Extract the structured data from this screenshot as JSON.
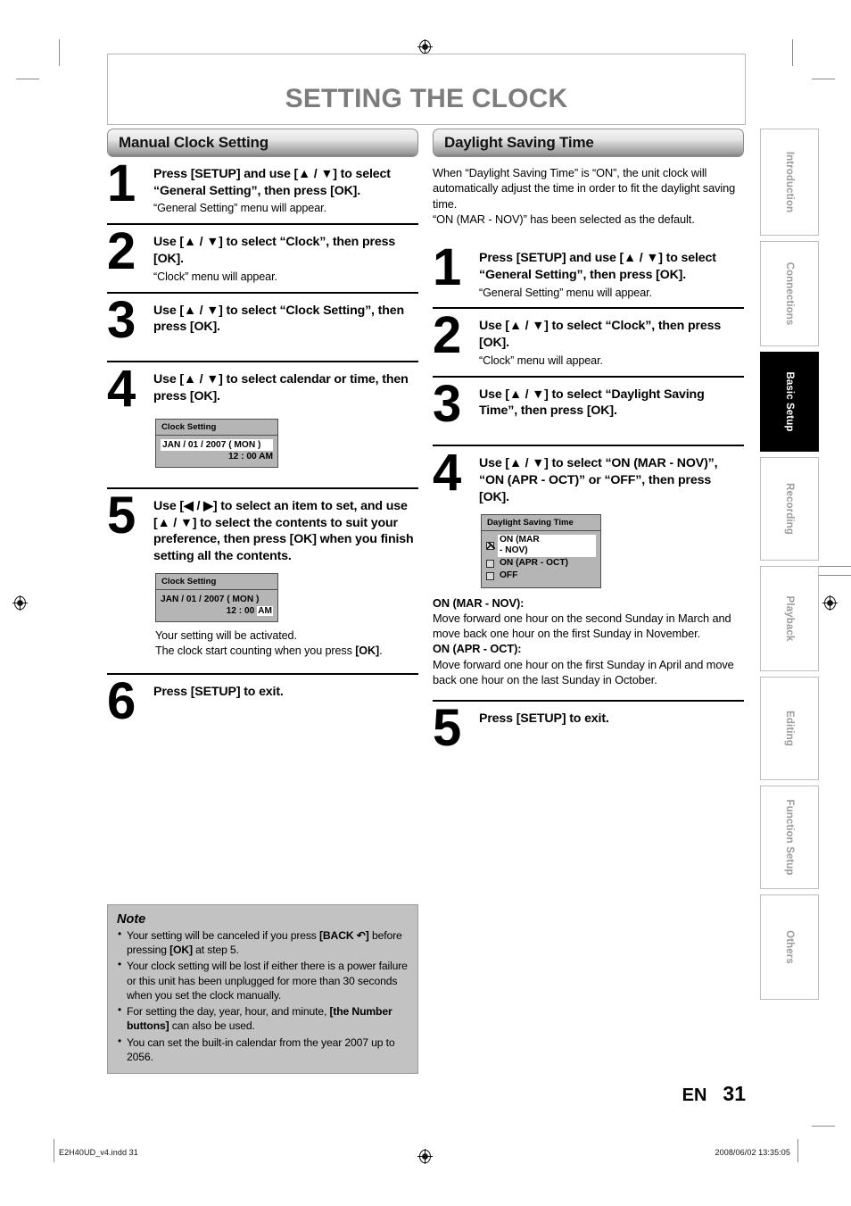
{
  "page": {
    "title": "SETTING THE CLOCK",
    "page_number": "31",
    "language_code": "EN",
    "imprint_left": "E2H40UD_v4.indd   31",
    "imprint_right": "2008/06/02   13:35:05"
  },
  "sidebar": {
    "tabs": [
      {
        "label": "Introduction",
        "active": false
      },
      {
        "label": "Connections",
        "active": false
      },
      {
        "label": "Basic Setup",
        "active": true
      },
      {
        "label": "Recording",
        "active": false
      },
      {
        "label": "Playback",
        "active": false
      },
      {
        "label": "Editing",
        "active": false
      },
      {
        "label": "Function Setup",
        "active": false
      },
      {
        "label": "Others",
        "active": false
      }
    ]
  },
  "left_column": {
    "section_title": "Manual Clock Setting",
    "steps": [
      {
        "number": "1",
        "head": "Press [SETUP] and use [▲ / ▼] to select “General Setting”, then press [OK].",
        "sub": "“General Setting” menu will appear."
      },
      {
        "number": "2",
        "head": "Use [▲ / ▼] to select “Clock”, then press [OK].",
        "sub": "“Clock” menu will appear."
      },
      {
        "number": "3",
        "head": "Use [▲ / ▼] to select “Clock Setting”, then press [OK].",
        "sub": ""
      },
      {
        "number": "4",
        "head": "Use [▲ / ▼] to select calendar or time, then press [OK].",
        "sub": ""
      },
      {
        "number": "5",
        "head": "Use [◀ / ▶] to select an item to set, and use [▲ / ▼] to select the contents to suit your preference, then press [OK] when you finish setting all the contents.",
        "sub": ""
      },
      {
        "number": "6",
        "head": "Press [SETUP] to exit.",
        "sub": ""
      }
    ],
    "osd_step4": {
      "title": "Clock Setting",
      "date": "JAN / 01 / 2007 ( MON )",
      "time_prefix": "12 : 00 ",
      "time_suffix": "AM",
      "highlight": "date"
    },
    "osd_step5": {
      "title": "Clock Setting",
      "date": "JAN / 01 / 2007 ( MON )",
      "time_prefix": "12 : 00 ",
      "time_suffix": "AM",
      "highlight": "ampm"
    },
    "step5_after_1": "Your setting will be activated.",
    "step5_after_2a": "The clock start counting when you press ",
    "step5_after_2b": "[OK]",
    "step5_after_2c": "."
  },
  "right_column": {
    "section_title": "Daylight Saving Time",
    "intro": "When “Daylight Saving Time” is “ON”, the unit clock will automatically adjust the time in order to fit the daylight saving time.\n“ON (MAR - NOV)” has been selected as the default.",
    "steps": [
      {
        "number": "1",
        "head": "Press [SETUP] and use [▲ / ▼] to select “General Setting”, then press [OK].",
        "sub": "“General Setting” menu will appear."
      },
      {
        "number": "2",
        "head": "Use [▲ / ▼] to select “Clock”, then press [OK].",
        "sub": "“Clock” menu will appear."
      },
      {
        "number": "3",
        "head": "Use [▲ / ▼] to select “Daylight Saving Time”, then press [OK].",
        "sub": ""
      },
      {
        "number": "4",
        "head": "Use [▲ / ▼] to select “ON (MAR - NOV)”, “ON (APR - OCT)” or “OFF”, then press [OK].",
        "sub": ""
      },
      {
        "number": "5",
        "head": "Press [SETUP] to exit.",
        "sub": ""
      }
    ],
    "osd_dst": {
      "title": "Daylight Saving Time",
      "options": [
        {
          "label": "ON (MAR - NOV)",
          "checked": true,
          "selected": true
        },
        {
          "label": "ON (APR - OCT)",
          "checked": false,
          "selected": false
        },
        {
          "label": "OFF",
          "checked": false,
          "selected": false
        }
      ]
    },
    "explanations": [
      {
        "term": "ON (MAR - NOV):",
        "text": "Move forward one hour on the second Sunday in March and move back one hour on the first Sunday in November."
      },
      {
        "term": "ON (APR - OCT):",
        "text": "Move forward one hour on the first Sunday in April and move back one hour on the last Sunday in October."
      }
    ]
  },
  "note": {
    "title": "Note",
    "items": [
      {
        "a": "Your setting will be canceled if you press ",
        "b": "[BACK ↶]",
        "c": " before pressing ",
        "d": "[OK]",
        "e": " at step 5."
      },
      {
        "a": "Your clock setting will be lost if either there is a power failure or this unit has been unplugged for more than 30 seconds when you set the clock manually.",
        "b": "",
        "c": "",
        "d": "",
        "e": ""
      },
      {
        "a": "For setting the day, year, hour, and minute, ",
        "b": "[the Number buttons]",
        "c": " can also be used.",
        "d": "",
        "e": ""
      },
      {
        "a": "You can set the built-in calendar from the year 2007 up to 2056.",
        "b": "",
        "c": "",
        "d": "",
        "e": ""
      }
    ]
  },
  "colors": {
    "title_gray": "#7c7c7c",
    "note_bg": "#c2c2c2",
    "osd_bg": "#b5b5b5",
    "tab_inactive_text": "#9c9c9c",
    "tab_active_bg": "#000000"
  }
}
